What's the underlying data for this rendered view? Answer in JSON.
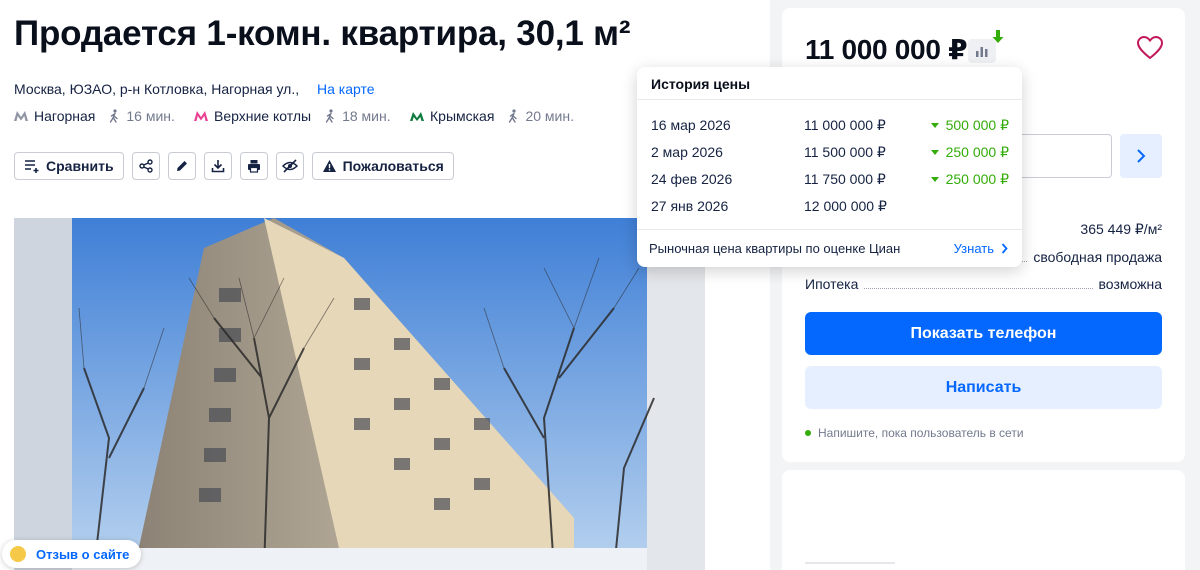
{
  "listing": {
    "title": "Продается 1-комн. квартира, 30,1 м²",
    "address": "Москва, ЮЗАО, р-н Котловка, Нагорная ул.,",
    "map_link": "На карте",
    "metro": [
      {
        "name": "Нагорная",
        "walk": "16 мин.",
        "color": "#8f95a3",
        "icon": "metro-m-icon"
      },
      {
        "name": "Верхние котлы",
        "walk": "18 мин.",
        "color": "#e84393",
        "icon": "metro-m-icon"
      },
      {
        "name": "Крымская",
        "walk": "20 мин.",
        "color": "#0f7a3e",
        "icon": "mcc-icon"
      }
    ]
  },
  "toolbar": {
    "compare_label": "Сравнить",
    "report_label": "Пожаловаться",
    "icons": [
      "compare-icon",
      "share-icon",
      "edit-icon",
      "download-icon",
      "print-icon",
      "hide-icon",
      "warning-icon"
    ]
  },
  "feedback": {
    "label": "Отзыв о сайте"
  },
  "sidebar": {
    "price": "11 000 000 ₽",
    "price_per_m2": "365 449 ₽/м²",
    "rows": [
      {
        "label": "",
        "value": "свободная продажа"
      },
      {
        "label": "Ипотека",
        "value": "возможна"
      }
    ],
    "show_phone": "Показать телефон",
    "write": "Написать",
    "online_note": "Напишите, пока пользователь в сети"
  },
  "price_history": {
    "title": "История цены",
    "rows": [
      {
        "date": "16 мар 2026",
        "price": "11 000 000 ₽",
        "change": "500 000 ₽"
      },
      {
        "date": "2 мар 2026",
        "price": "11 500 000 ₽",
        "change": "250 000 ₽"
      },
      {
        "date": "24 фев 2026",
        "price": "11 750 000 ₽",
        "change": "250 000 ₽"
      },
      {
        "date": "27 янв 2026",
        "price": "12 000 000 ₽",
        "change": ""
      }
    ],
    "market_note": "Рыночная цена квартиры по оценке Циан",
    "market_link": "Узнать"
  },
  "colors": {
    "accent": "#0468ff",
    "accent_light": "#e6efff",
    "price_down": "#34ac0a",
    "text": "#152242"
  }
}
